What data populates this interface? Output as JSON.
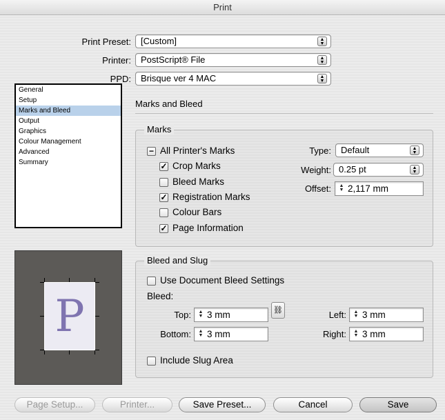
{
  "window": {
    "title": "Print"
  },
  "preset": {
    "print_preset_label": "Print Preset:",
    "print_preset_value": "[Custom]",
    "printer_label": "Printer:",
    "printer_value": "PostScript® File",
    "ppd_label": "PPD:",
    "ppd_value": "Brisque ver 4 MAC"
  },
  "sidebar": {
    "items": [
      "General",
      "Setup",
      "Marks and Bleed",
      "Output",
      "Graphics",
      "Colour Management",
      "Advanced",
      "Summary"
    ],
    "selected": "Marks and Bleed"
  },
  "panel": {
    "title": "Marks and Bleed"
  },
  "marks": {
    "group_label": "Marks",
    "all_printers_marks": "All Printer's Marks",
    "crop_marks": "Crop Marks",
    "bleed_marks": "Bleed Marks",
    "registration_marks": "Registration Marks",
    "colour_bars": "Colour Bars",
    "page_information": "Page Information",
    "type_label": "Type:",
    "type_value": "Default",
    "weight_label": "Weight:",
    "weight_value": "0.25 pt",
    "offset_label": "Offset:",
    "offset_value": "2,117 mm",
    "checked": {
      "all_printers_marks": "mixed",
      "crop_marks": true,
      "bleed_marks": false,
      "registration_marks": true,
      "colour_bars": false,
      "page_information": true
    }
  },
  "bleed": {
    "group_label": "Bleed and Slug",
    "use_document_bleed": "Use Document Bleed Settings",
    "bleed_label": "Bleed:",
    "top_label": "Top:",
    "top_value": "3 mm",
    "bottom_label": "Bottom:",
    "bottom_value": "3 mm",
    "left_label": "Left:",
    "left_value": "3 mm",
    "right_label": "Right:",
    "right_value": "3 mm",
    "include_slug": "Include Slug Area"
  },
  "preview": {
    "letter": "P",
    "letter_color": "#7f74b0",
    "background": "#5c5a57"
  },
  "buttons": {
    "page_setup": "Page Setup...",
    "printer": "Printer...",
    "save_preset": "Save Preset...",
    "cancel": "Cancel",
    "save": "Save"
  },
  "icons": {
    "popup_arrows": "up-down-arrows-icon",
    "stepper": "stepper-arrows-icon",
    "chain": "chain-link-icon"
  }
}
